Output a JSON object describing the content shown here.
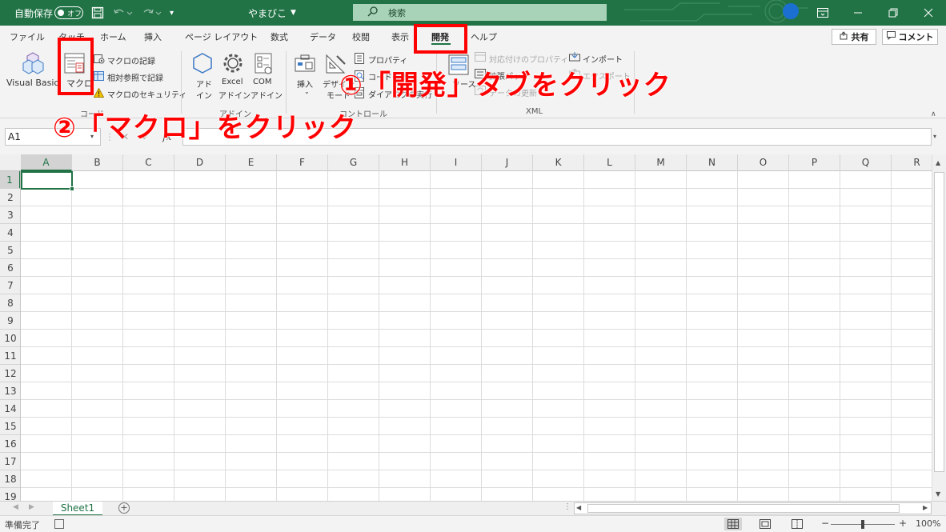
{
  "titlebar": {
    "autosave_label": "自動保存",
    "autosave_state": "オフ",
    "document_title": "やまびこ",
    "search_placeholder": "検索"
  },
  "menu": {
    "tabs": [
      "ファイル",
      "タッチ",
      "ホーム",
      "挿入",
      "ページ レイアウト",
      "数式",
      "データ",
      "校閲",
      "表示",
      "開発",
      "ヘルプ"
    ],
    "active_tab": "開発",
    "share_label": "共有",
    "comment_label": "コメント"
  },
  "ribbon": {
    "visual_basic": "Visual Basic",
    "macro": "マクロ",
    "record_macro": "マクロの記録",
    "relative_ref": "相対参照で記録",
    "macro_security": "マクロのセキュリティ",
    "group_code": "コード",
    "addin1": "アド",
    "addin2": "イン",
    "excel_addin1": "Excel",
    "excel_addin2": "アドイン",
    "com_addin1": "COM",
    "com_addin2": "アドイン",
    "group_addin": "アドイン",
    "insert": "挿入",
    "design_mode1": "デザイン",
    "design_mode2": "モード",
    "properties": "プロパティ",
    "view_code": "コードの表示",
    "run_dialog": "ダイアログの実行",
    "group_controls": "コントロール",
    "source": "ソース",
    "map_properties": "対応付けのプロパティ",
    "expansion_packs": "拡張パック",
    "refresh_data": "データの更新",
    "import": "インポート",
    "export": "エクスポート",
    "group_xml": "XML"
  },
  "formula_bar": {
    "name_box": "A1",
    "fx": "fx",
    "cancel": "✕",
    "enter": "✓"
  },
  "grid": {
    "columns": [
      "A",
      "B",
      "C",
      "D",
      "E",
      "F",
      "G",
      "H",
      "I",
      "J",
      "K",
      "L",
      "M",
      "N",
      "O",
      "P",
      "Q",
      "R"
    ],
    "rows": [
      "1",
      "2",
      "3",
      "4",
      "5",
      "6",
      "7",
      "8",
      "9",
      "10",
      "11",
      "12",
      "13",
      "14",
      "15",
      "16",
      "17",
      "18",
      "19"
    ],
    "active_cell": "A1"
  },
  "sheets": {
    "tabs": [
      "Sheet1"
    ],
    "active": "Sheet1",
    "add_symbol": "+"
  },
  "status": {
    "text": "準備完了",
    "zoom": "100%",
    "zoom_fraction": 0.5
  },
  "annotations": {
    "step1": "①「開発」タブをクリック",
    "step2": "②「マクロ」をクリック",
    "color": "#ff0000"
  },
  "colors": {
    "excel_green": "#217346",
    "search_box": "#a9d3b8"
  }
}
